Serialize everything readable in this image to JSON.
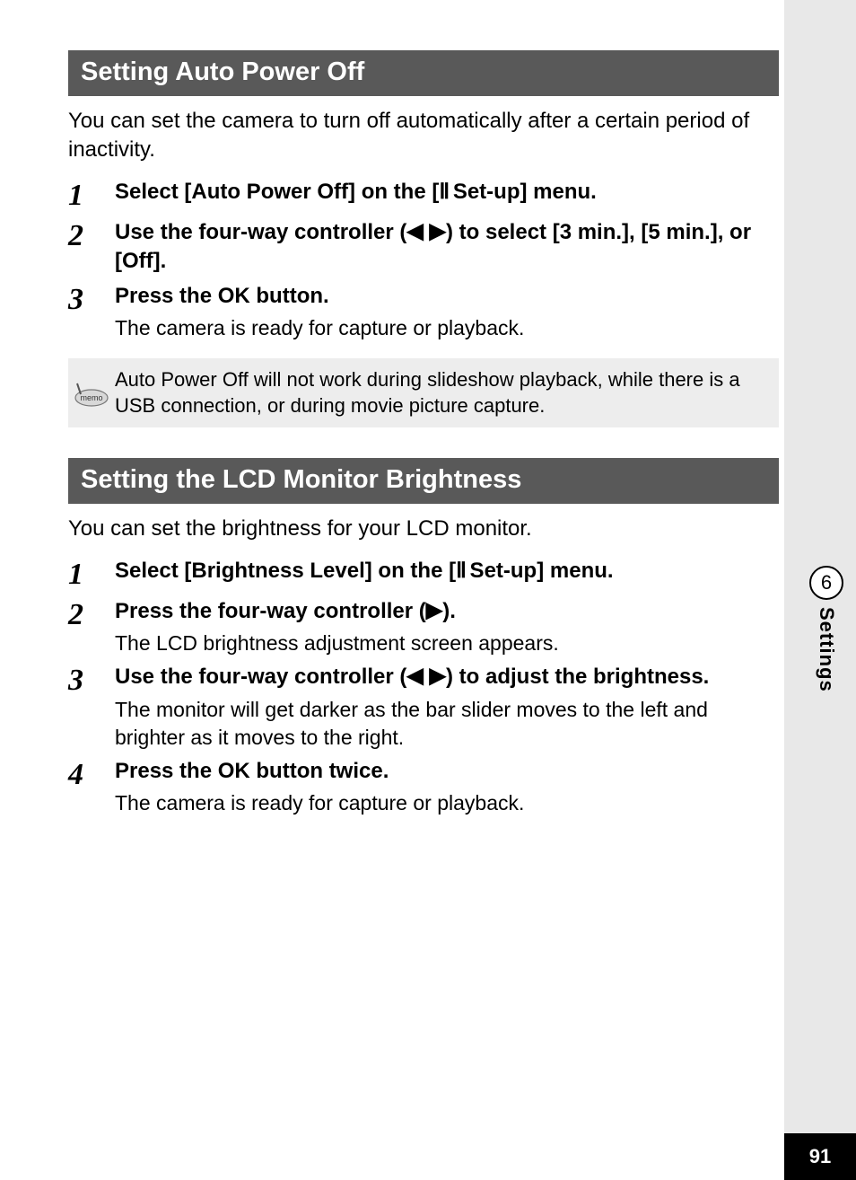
{
  "sidebar": {
    "chapter_number": "6",
    "chapter_label": "Settings"
  },
  "page_number": "91",
  "arrows": {
    "left": "◀",
    "right": "▶"
  },
  "setup_icon": "Ⅱ",
  "sections": [
    {
      "heading": "Setting Auto Power Off",
      "intro": "You can set the camera to turn off automatically after a certain period of inactivity.",
      "steps": [
        {
          "num": "1",
          "title_pre": "Select [Auto Power Off] on the [",
          "title_post": " Set-up] menu.",
          "has_icon": true
        },
        {
          "num": "2",
          "title_pre": "Use the four-way controller (",
          "title_mid": ") to select [3 min.], [5 min.], or [Off].",
          "arrows": "both"
        },
        {
          "num": "3",
          "title_pre": "Press the OK button.",
          "sub": "The camera is ready for capture or playback."
        }
      ],
      "memo": "Auto Power Off will not work during slideshow playback, while there is a USB connection, or during movie picture capture."
    },
    {
      "heading": "Setting the LCD Monitor Brightness",
      "intro": "You can set the brightness for your LCD monitor.",
      "steps": [
        {
          "num": "1",
          "title_pre": "Select [Brightness Level] on the [",
          "title_post": " Set-up] menu.",
          "has_icon": true
        },
        {
          "num": "2",
          "title_pre": "Press the four-way controller (",
          "title_mid": ").",
          "arrows": "right",
          "sub": "The LCD brightness adjustment screen appears."
        },
        {
          "num": "3",
          "title_pre": "Use the four-way controller (",
          "title_mid": ") to adjust the brightness.",
          "arrows": "both",
          "sub": "The monitor will get darker as the bar slider moves to the left and brighter as it moves to the right."
        },
        {
          "num": "4",
          "title_pre": "Press the OK button twice.",
          "sub": "The camera is ready for capture or playback."
        }
      ]
    }
  ]
}
